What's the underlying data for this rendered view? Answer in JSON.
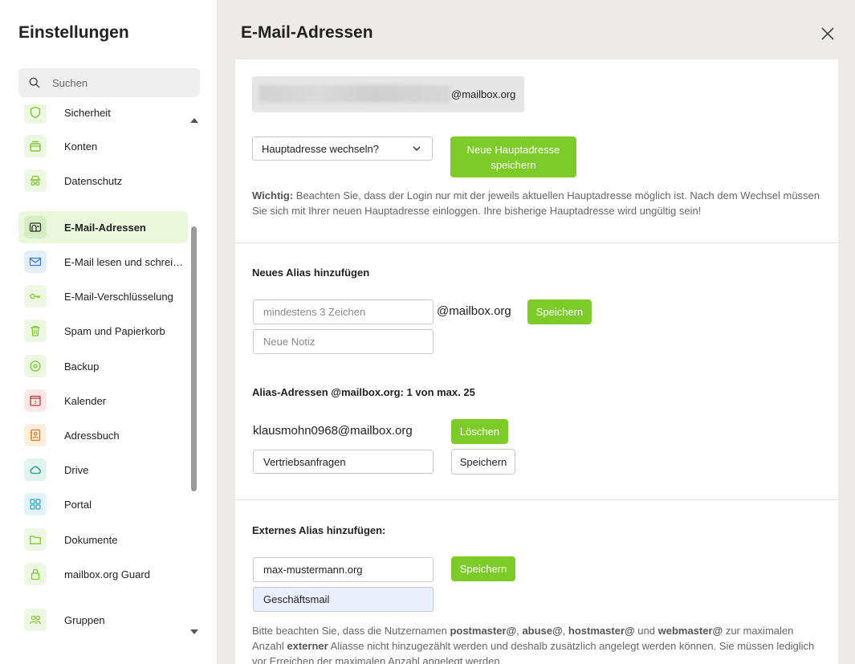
{
  "sidebar": {
    "title": "Einstellungen",
    "search_placeholder": "Suchen",
    "items": [
      {
        "label": "Sicherheit",
        "icon": "shield-icon"
      },
      {
        "label": "Konten",
        "icon": "accounts-icon"
      },
      {
        "label": "Datenschutz",
        "icon": "incognito-icon"
      },
      {
        "label": "E-Mail-Adressen",
        "icon": "address-card-icon"
      },
      {
        "label": "E-Mail lesen und schreiben",
        "icon": "envelope-icon"
      },
      {
        "label": "E-Mail-Verschlüsselung",
        "icon": "key-icon"
      },
      {
        "label": "Spam und Papierkorb",
        "icon": "trash-icon"
      },
      {
        "label": "Backup",
        "icon": "backup-icon"
      },
      {
        "label": "Kalender",
        "icon": "calendar-icon"
      },
      {
        "label": "Adressbuch",
        "icon": "contacts-icon"
      },
      {
        "label": "Drive",
        "icon": "cloud-icon"
      },
      {
        "label": "Portal",
        "icon": "grid-icon"
      },
      {
        "label": "Dokumente",
        "icon": "folder-icon"
      },
      {
        "label": "mailbox.org Guard",
        "icon": "lock-icon"
      },
      {
        "label": "Gruppen",
        "icon": "group-icon"
      }
    ],
    "calendar_day": "3"
  },
  "main": {
    "title": "E-Mail-Adressen",
    "primary": {
      "address_domain": "@mailbox.org",
      "change_select": "Hauptadresse wechseln?",
      "save_button": "Neue Hauptadresse speichern",
      "note_strong": "Wichtig:",
      "note_text": " Beachten Sie, dass der Login nur mit der jeweils aktuellen Hauptadresse möglich ist. Nach dem Wechsel müssen Sie sich mit Ihrer neuen Hauptadresse einloggen. Ihre bisherige Hauptadresse wird ungültig sein!"
    },
    "new_alias": {
      "heading": "Neues Alias hinzufügen",
      "name_placeholder": "mindestens 3 Zeichen",
      "domain": "@mailbox.org",
      "save_button": "Speichern",
      "note_placeholder": "Neue Notiz"
    },
    "alias_list": {
      "heading": "Alias-Adressen @mailbox.org: 1 von max. 25",
      "address": "klausmohn0968@mailbox.org",
      "delete_button": "Löschen",
      "note_value": "Vertriebsanfragen",
      "save_button": "Speichern"
    },
    "external_alias": {
      "heading": "Externes Alias hinzufügen:",
      "domain_value": "max-mustermann.org",
      "save_button": "Speichern",
      "note_value": "Geschäftsmail",
      "info_p1": "Bitte beachten Sie, dass die Nutzernamen ",
      "info_b1": "postmaster@",
      "info_s1": ", ",
      "info_b2": "abuse@",
      "info_s2": ", ",
      "info_b3": "hostmaster@",
      "info_s3": " und ",
      "info_b4": "webmaster@",
      "info_p2": " zur maximalen Anzahl ",
      "info_b5": "externer",
      "info_p3": " Aliasse nicht hinzugezählt werden und deshalb zusätzlich angelegt werden können. Sie müssen lediglich vor Erreichen der maximalen Anzahl angelegt werden."
    }
  },
  "colors": {
    "accent_green": "#7ccb28",
    "active_bg": "#e9f7dc"
  }
}
